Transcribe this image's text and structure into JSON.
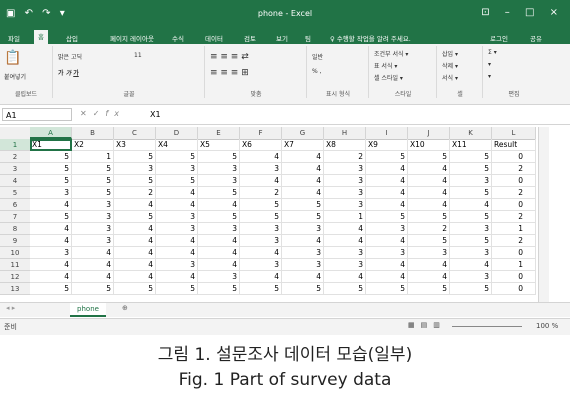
{
  "window": {
    "title": "phone - Excel",
    "controls": "⊡ – □ ×"
  },
  "quick_access": "▣ ↶ ↷ ▾",
  "tabs": [
    "파일",
    "홈",
    "삽입",
    "페이지 레이아웃",
    "수식",
    "데이터",
    "검토",
    "보기",
    "팀",
    "♀ 수행할 작업을 알려 주세요."
  ],
  "account": {
    "login": "로그인",
    "share": "공유"
  },
  "ribbon": {
    "clipboard": {
      "label": "클립보드",
      "paste": "붙여넣기"
    },
    "font": {
      "label": "글꼴",
      "name": "맑은 고딕",
      "size": "11"
    },
    "align": {
      "label": "맞춤"
    },
    "number": {
      "label": "표시 형식",
      "format": "일반"
    },
    "style": {
      "label": "스타일",
      "items": [
        "조건부 서식 ▾",
        "표 서식 ▾",
        "셀 스타일 ▾"
      ]
    },
    "cells": {
      "label": "셀",
      "items": [
        "삽입 ▾",
        "삭제 ▾",
        "서식 ▾"
      ]
    },
    "edit": {
      "label": "편집",
      "items": [
        "Σ ▾",
        "▾",
        "▾"
      ]
    }
  },
  "formula_bar": {
    "name_box": "A1",
    "value": "X1"
  },
  "columns": [
    "A",
    "B",
    "C",
    "D",
    "E",
    "F",
    "G",
    "H",
    "I",
    "J",
    "K",
    "L"
  ],
  "rows": [
    [
      "X1",
      "X2",
      "X3",
      "X4",
      "X5",
      "X6",
      "X7",
      "X8",
      "X9",
      "X10",
      "X11",
      "Result"
    ],
    [
      "5",
      "1",
      "5",
      "5",
      "5",
      "4",
      "4",
      "2",
      "5",
      "5",
      "5",
      "0"
    ],
    [
      "5",
      "5",
      "3",
      "3",
      "3",
      "3",
      "4",
      "3",
      "4",
      "4",
      "5",
      "2"
    ],
    [
      "5",
      "5",
      "5",
      "5",
      "3",
      "4",
      "4",
      "3",
      "4",
      "4",
      "3",
      "0"
    ],
    [
      "3",
      "5",
      "2",
      "4",
      "5",
      "2",
      "4",
      "3",
      "4",
      "4",
      "5",
      "2"
    ],
    [
      "4",
      "3",
      "4",
      "4",
      "4",
      "5",
      "5",
      "3",
      "4",
      "4",
      "4",
      "0"
    ],
    [
      "5",
      "3",
      "5",
      "3",
      "5",
      "5",
      "5",
      "1",
      "5",
      "5",
      "5",
      "2"
    ],
    [
      "4",
      "3",
      "4",
      "3",
      "3",
      "3",
      "3",
      "4",
      "3",
      "2",
      "3",
      "1"
    ],
    [
      "4",
      "3",
      "4",
      "4",
      "4",
      "3",
      "4",
      "4",
      "4",
      "5",
      "5",
      "2"
    ],
    [
      "3",
      "4",
      "4",
      "4",
      "4",
      "4",
      "3",
      "3",
      "3",
      "3",
      "3",
      "0"
    ],
    [
      "4",
      "4",
      "4",
      "3",
      "4",
      "3",
      "3",
      "3",
      "4",
      "4",
      "4",
      "1"
    ],
    [
      "4",
      "4",
      "4",
      "4",
      "3",
      "4",
      "4",
      "4",
      "4",
      "4",
      "3",
      "0"
    ],
    [
      "5",
      "5",
      "5",
      "5",
      "5",
      "5",
      "5",
      "5",
      "5",
      "5",
      "5",
      "0"
    ]
  ],
  "sheet_tab": "phone",
  "add_sheet": "⊕",
  "status": {
    "mode": "준비",
    "zoom": "100 %"
  },
  "caption": {
    "korean": "그림 1. 설문조사 데이터 모습(일부)",
    "english": "Fig. 1 Part of survey data"
  },
  "colors": {
    "excel_green": "#217346"
  }
}
